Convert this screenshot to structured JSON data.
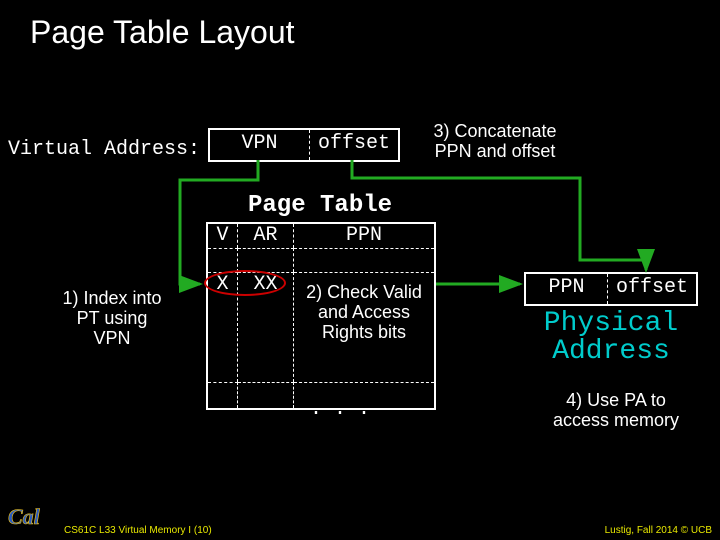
{
  "title": "Page Table Layout",
  "va_label": "Virtual Address:",
  "va": {
    "vpn": "VPN",
    "offset": "offset"
  },
  "step3": "3) Concatenate PPN and offset",
  "pt_title": "Page Table",
  "pt_headers": {
    "v": "V",
    "ar": "AR",
    "ppn": "PPN"
  },
  "pt_entry": {
    "x1": "X",
    "x2": "XX"
  },
  "step1": "1) Index into PT using VPN",
  "step2": "2) Check Valid and Access Rights bits",
  "dots": ". . .",
  "pa": {
    "ppn": "PPN",
    "offset": "offset"
  },
  "pa_label": "Physical Address",
  "step4": "4) Use PA to access memory",
  "footer_left": "CS61C L33 Virtual Memory I (10)",
  "footer_right": "Lustig, Fall 2014 © UCB",
  "chart_data": {
    "type": "diagram",
    "title": "Page Table Layout",
    "components": {
      "virtual_address": {
        "fields": [
          "VPN",
          "offset"
        ]
      },
      "page_table": {
        "columns": [
          "V",
          "AR",
          "PPN"
        ],
        "highlighted_row": {
          "V": "X",
          "AR": "XX"
        }
      },
      "physical_address": {
        "fields": [
          "PPN",
          "offset"
        ]
      }
    },
    "steps": [
      "1) Index into PT using VPN",
      "2) Check Valid and Access Rights bits",
      "3) Concatenate PPN and offset",
      "4) Use PA to access memory"
    ],
    "arrows": [
      {
        "from": "VirtualAddress.VPN",
        "to": "PageTable.index",
        "color": "green"
      },
      {
        "from": "VirtualAddress.offset",
        "to": "PhysicalAddress.offset",
        "color": "green"
      },
      {
        "from": "PageTable.PPN",
        "to": "PhysicalAddress.PPN",
        "color": "green"
      }
    ]
  }
}
